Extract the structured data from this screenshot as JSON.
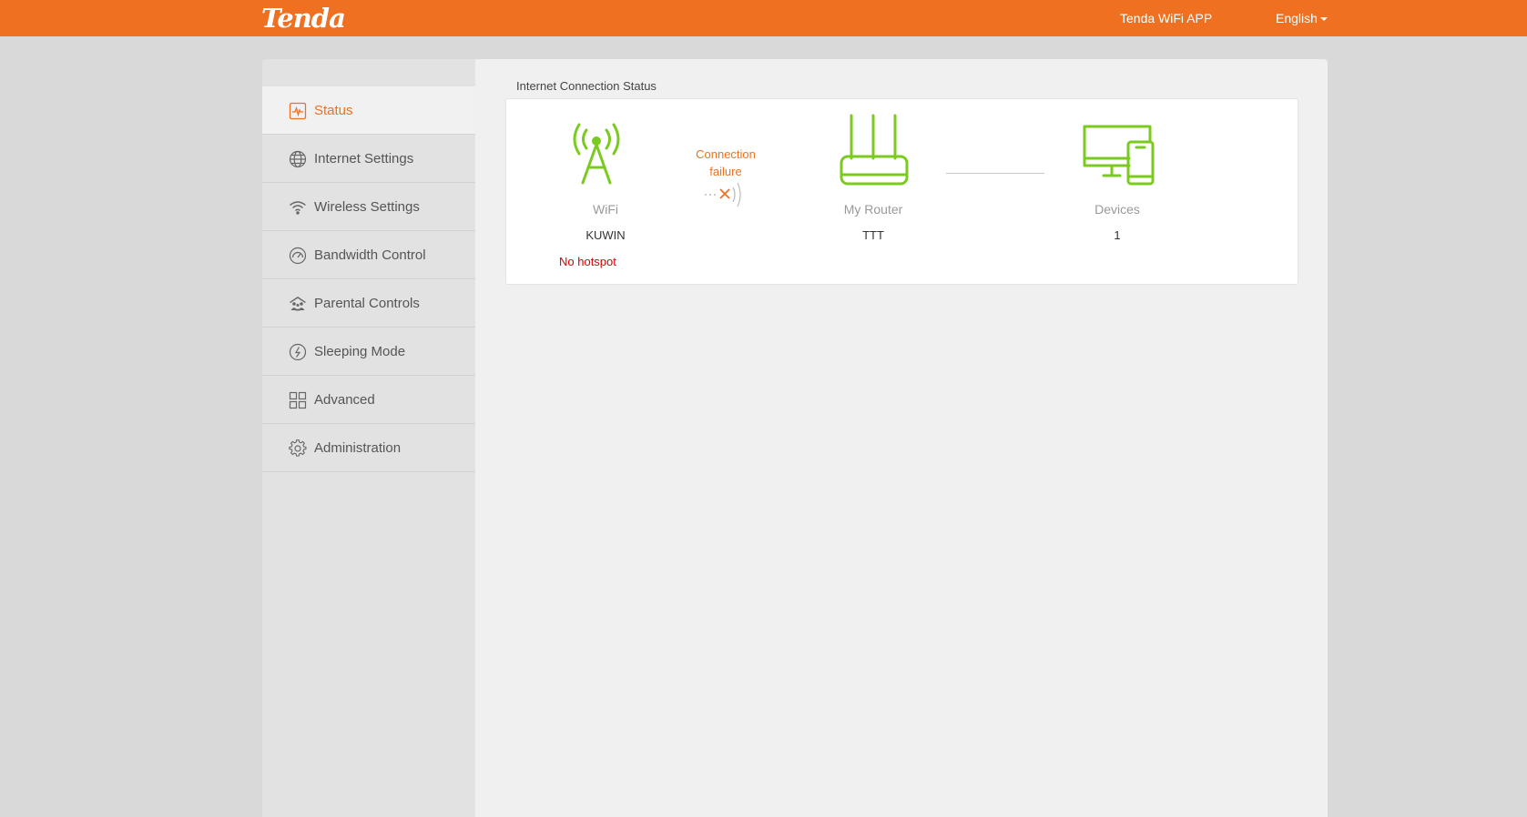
{
  "header": {
    "brand": "Tenda",
    "app_link": "Tenda WiFi APP",
    "language": "English"
  },
  "sidebar": {
    "items": [
      {
        "label": "Status",
        "icon": "status-chart-icon",
        "active": true
      },
      {
        "label": "Internet Settings",
        "icon": "globe-icon"
      },
      {
        "label": "Wireless Settings",
        "icon": "wifi-icon"
      },
      {
        "label": "Bandwidth Control",
        "icon": "speedometer-icon"
      },
      {
        "label": "Parental Controls",
        "icon": "family-icon"
      },
      {
        "label": "Sleeping Mode",
        "icon": "moon-clock-icon"
      },
      {
        "label": "Advanced",
        "icon": "grid-icon"
      },
      {
        "label": "Administration",
        "icon": "gear-icon"
      }
    ]
  },
  "main": {
    "section_title": "Internet Connection Status",
    "connection_status": "Connection failure",
    "wifi": {
      "label": "WiFi",
      "value": "KUWIN",
      "warning": "No hotspot",
      "icon": "antenna-tower-icon"
    },
    "router": {
      "label": "My Router",
      "value": "TTT",
      "icon": "router-icon"
    },
    "devices": {
      "label": "Devices",
      "value": "1",
      "icon": "devices-icon"
    }
  },
  "colors": {
    "accent": "#ee7020",
    "icon_green": "#7bcb1f",
    "warning_red": "#d40000",
    "page_bg": "#d9d9d9"
  }
}
